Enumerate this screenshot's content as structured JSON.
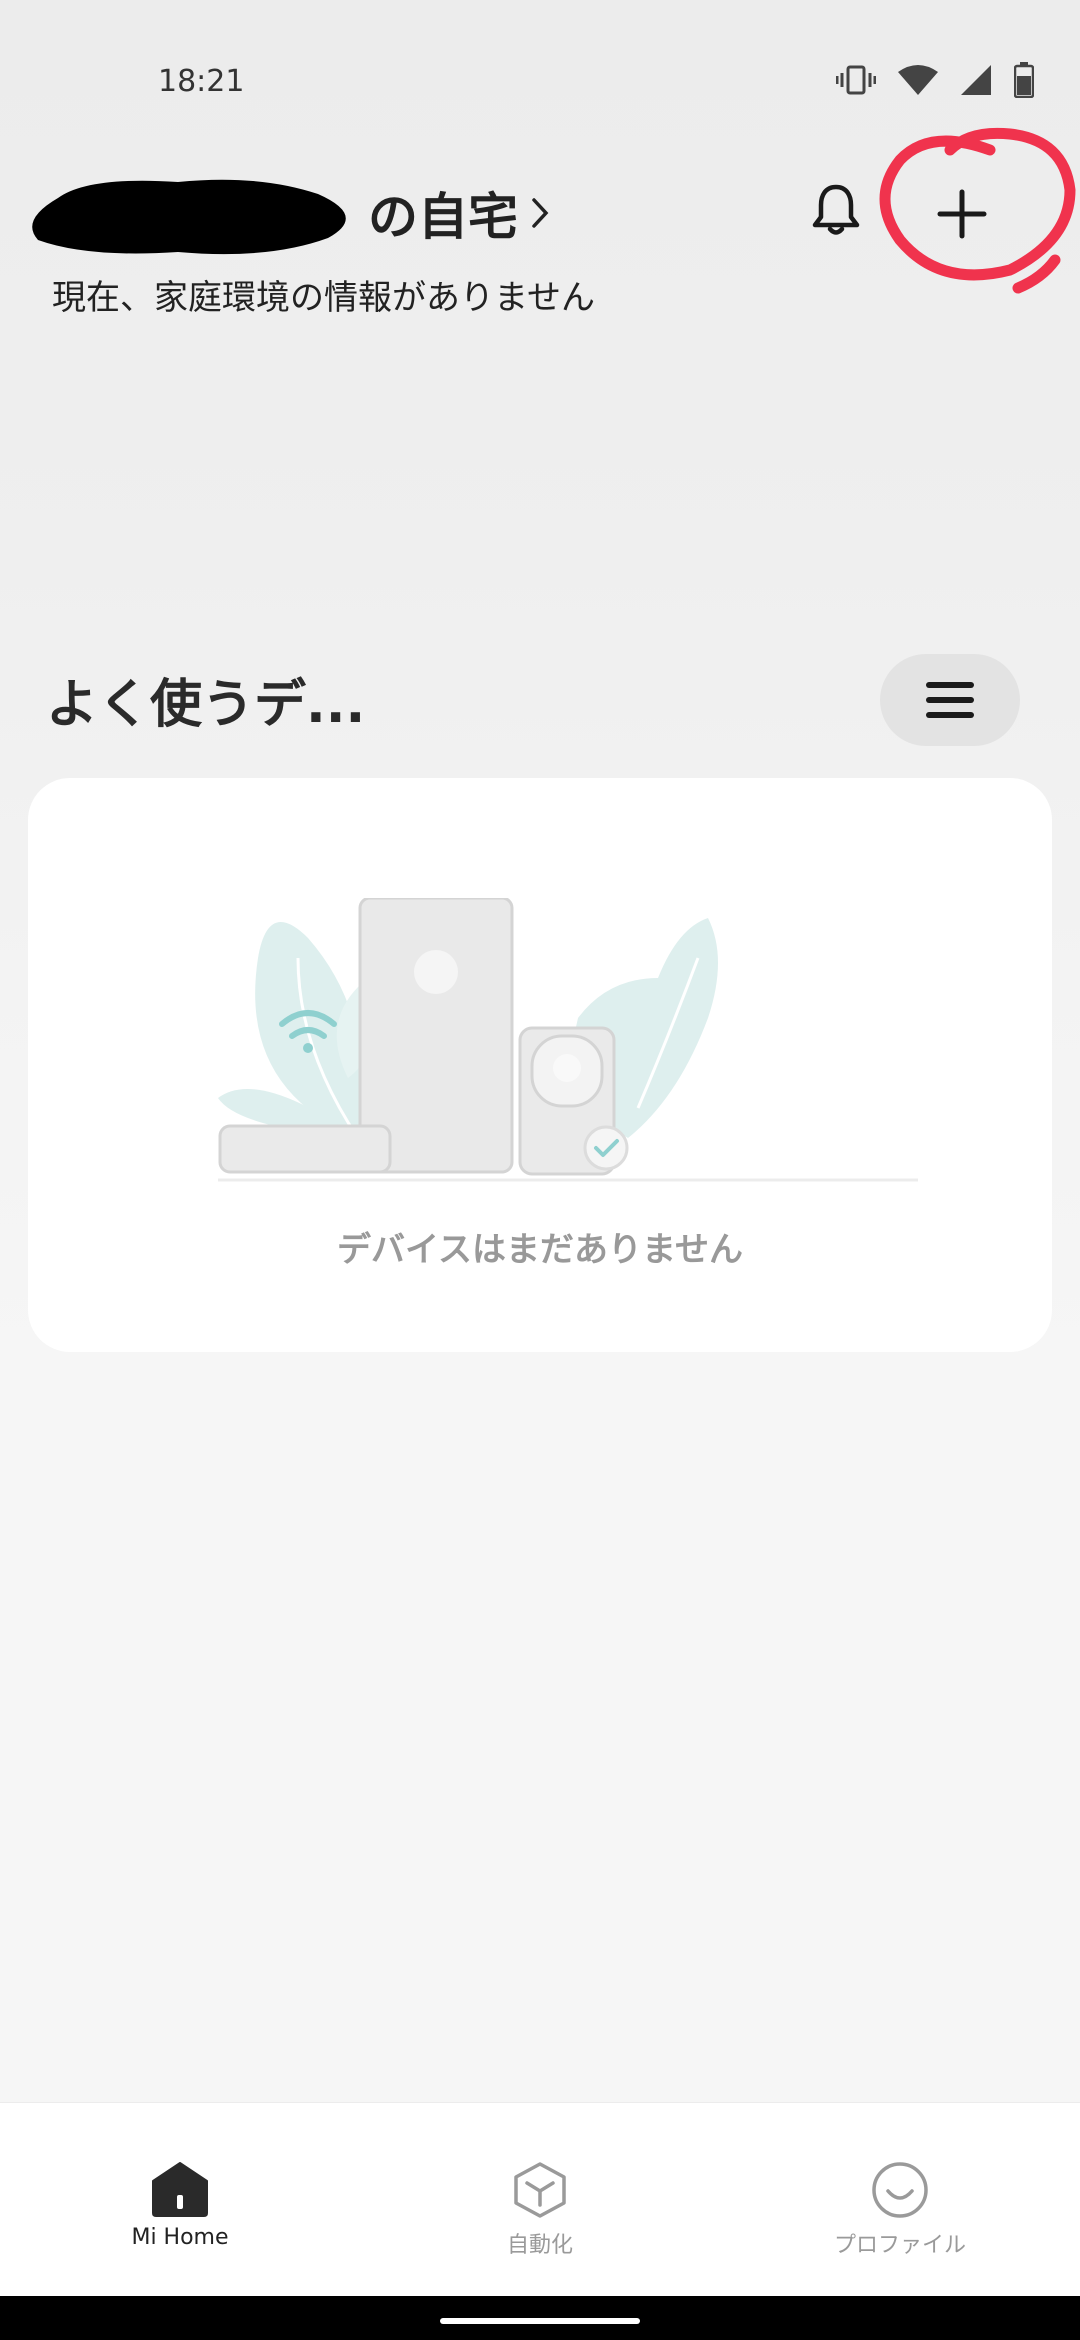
{
  "status_bar": {
    "time": "18:21",
    "icons": [
      "vibrate-icon",
      "wifi-icon",
      "signal-icon",
      "battery-icon"
    ]
  },
  "header": {
    "home_title": "の自宅",
    "home_subtitle": "現在、家庭環境の情報がありません",
    "notification_icon": "bell-icon",
    "add_icon": "plus-icon",
    "annotation_color": "#f0334d"
  },
  "favorites": {
    "title": "よく使うデ...",
    "menu_icon": "hamburger-icon",
    "empty_message": "デバイスはまだありません"
  },
  "bottom_nav": {
    "items": [
      {
        "label": "Mi Home",
        "icon": "home-icon",
        "active": true
      },
      {
        "label": "自動化",
        "icon": "automation-cube-icon",
        "active": false
      },
      {
        "label": "プロファイル",
        "icon": "profile-smile-icon",
        "active": false
      }
    ]
  },
  "colors": {
    "accent_teal": "#8fd0cf",
    "text_dark": "#222222",
    "text_muted": "#999999"
  }
}
